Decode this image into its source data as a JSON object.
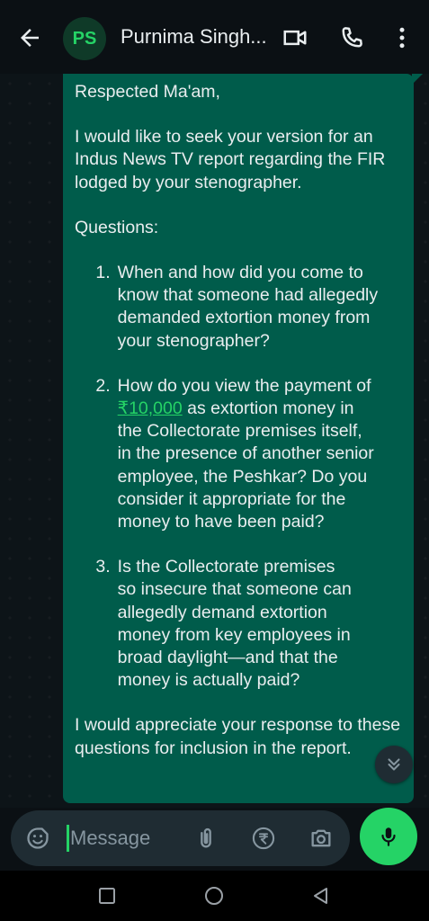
{
  "header": {
    "avatar_initials": "PS",
    "contact_name": "Purnima Singh...",
    "icons": [
      "back-arrow-icon",
      "video-call-icon",
      "phone-icon",
      "more-vert-icon"
    ]
  },
  "message": {
    "greeting": "Respected Ma'am,",
    "intro": "I would like to seek your version for an Indus News TV report regarding the FIR lodged by your stenographer.",
    "questions_heading": "Questions:",
    "questions": [
      {
        "num": "1.",
        "lines": [
          "When and how did you come to",
          "know that someone had allegedly",
          "demanded extortion money from",
          "your stenographer?"
        ]
      },
      {
        "num": "2.",
        "line1_amount": "₹10,000",
        "line1_rest": " as extortion money in",
        "line0": "How do you view the payment of",
        "lines_after": [
          "the Collectorate premises itself,",
          "in the presence of another senior",
          "employee, the Peshkar? Do you",
          "consider it appropriate for the",
          "money to have been paid?"
        ]
      },
      {
        "num": "3.",
        "lines": [
          "Is the Collectorate premises",
          "so insecure that someone can",
          "allegedly demand extortion",
          "money from key employees in",
          "broad daylight—and that the",
          "money is actually paid?"
        ]
      }
    ],
    "closing": "I would appreciate your response to these questions for inclusion in the report."
  },
  "composer": {
    "placeholder": "Message",
    "icons": [
      "sticker-icon",
      "attach-icon",
      "rupee-payment-icon",
      "camera-icon",
      "mic-icon"
    ]
  },
  "colors": {
    "bubble": "#005c4b",
    "accent": "#25d366",
    "background": "#0b1014"
  }
}
